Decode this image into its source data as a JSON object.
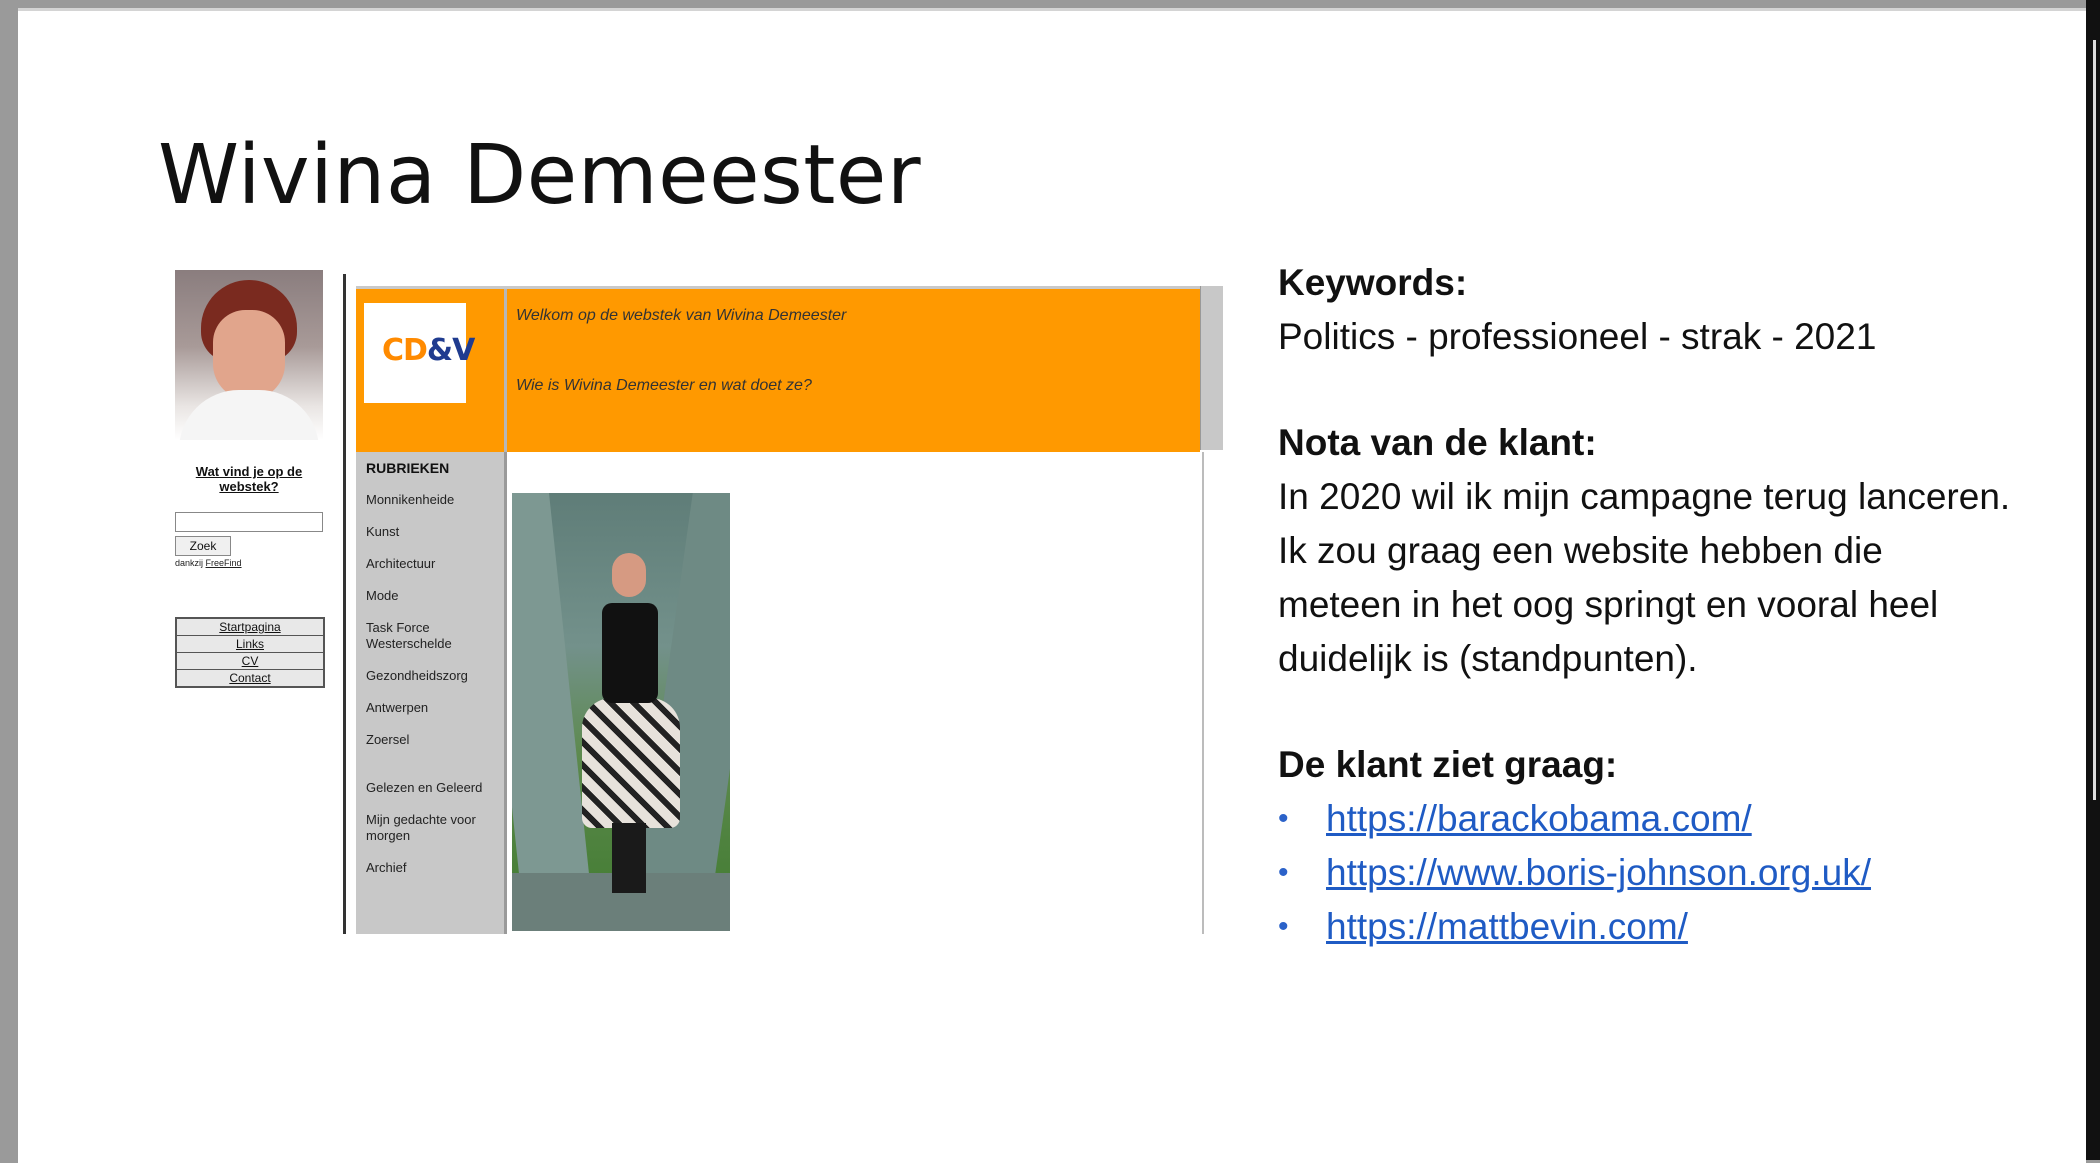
{
  "slide": {
    "title": "Wivina Demeester"
  },
  "old_site": {
    "left_panel": {
      "question_link": "Wat vind je op de webstek?",
      "search_button": "Zoek",
      "credit_prefix": "dankzij",
      "credit_link": "FreeFind",
      "menu": [
        "Startpagina",
        "Links",
        "CV",
        "Contact"
      ]
    },
    "header": {
      "logo_text_1": "CD",
      "logo_text_2": "&V",
      "welcome": "Welkom op de webstek van Wivina Demeester",
      "who": "Wie is Wivina Demeester en wat doet ze?"
    },
    "nav": {
      "title": "RUBRIEKEN",
      "items": [
        "Monnikenheide",
        "Kunst",
        "Architectuur",
        "Mode",
        "Task Force Westerschelde",
        "Gezondheidszorg",
        "Antwerpen",
        "Zoersel",
        "Gelezen en Geleerd",
        "Mijn gedachte voor morgen",
        "Archief"
      ]
    }
  },
  "brief": {
    "keywords_label": "Keywords:",
    "keywords_text": "Politics - professioneel - strak - 2021",
    "note_label": "Nota van de klant:",
    "note_lines": [
      "In 2020 wil ik mijn campagne terug lanceren.",
      "Ik zou graag een website hebben die",
      "meteen in het oog springt en vooral heel",
      "duidelijk is (standpunten)."
    ],
    "likes_label": "De klant ziet graag:",
    "links": [
      "https://barackobama.com/",
      "https://www.boris-johnson.org.uk/",
      "https://mattbevin.com/"
    ]
  }
}
